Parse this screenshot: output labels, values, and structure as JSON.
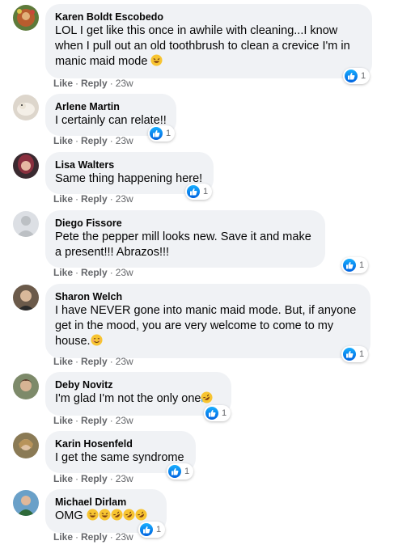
{
  "colors": {
    "bubble": "#f0f2f5",
    "like": "#1877f2",
    "meta": "#65676b"
  },
  "comments": [
    {
      "author": "Karen Boldt Escobedo",
      "text": "LOL I get like this once in awhile with cleaning...I know when I pull out an old toothbrush to clean a crevice I'm in manic maid mode",
      "like": "Like",
      "reply": "Reply",
      "time": "23w",
      "reactions": "1"
    },
    {
      "author": "Arlene Martin",
      "text": "I certainly can relate!!",
      "like": "Like",
      "reply": "Reply",
      "time": "23w",
      "reactions": "1"
    },
    {
      "author": "Lisa Walters",
      "text": "Same thing happening here!",
      "like": "Like",
      "reply": "Reply",
      "time": "23w",
      "reactions": "1"
    },
    {
      "author": "Diego Fissore",
      "text": "Pete the pepper mill looks new. Save it and make a present!!! Abrazos!!!",
      "like": "Like",
      "reply": "Reply",
      "time": "23w",
      "reactions": "1"
    },
    {
      "author": "Sharon Welch",
      "text": "I have NEVER gone into manic maid mode. But, if anyone get in the mood, you are very welcome to come to my house.",
      "like": "Like",
      "reply": "Reply",
      "time": "23w",
      "reactions": "1"
    },
    {
      "author": "Deby Novitz",
      "text": "I'm glad I'm not the only one",
      "like": "Like",
      "reply": "Reply",
      "time": "23w",
      "reactions": "1"
    },
    {
      "author": "Karin Hosenfeld",
      "text": "I get the same syndrome",
      "like": "Like",
      "reply": "Reply",
      "time": "23w",
      "reactions": "1"
    },
    {
      "author": "Michael Dirlam",
      "text": "OMG",
      "like": "Like",
      "reply": "Reply",
      "time": "23w",
      "reactions": "1"
    }
  ]
}
